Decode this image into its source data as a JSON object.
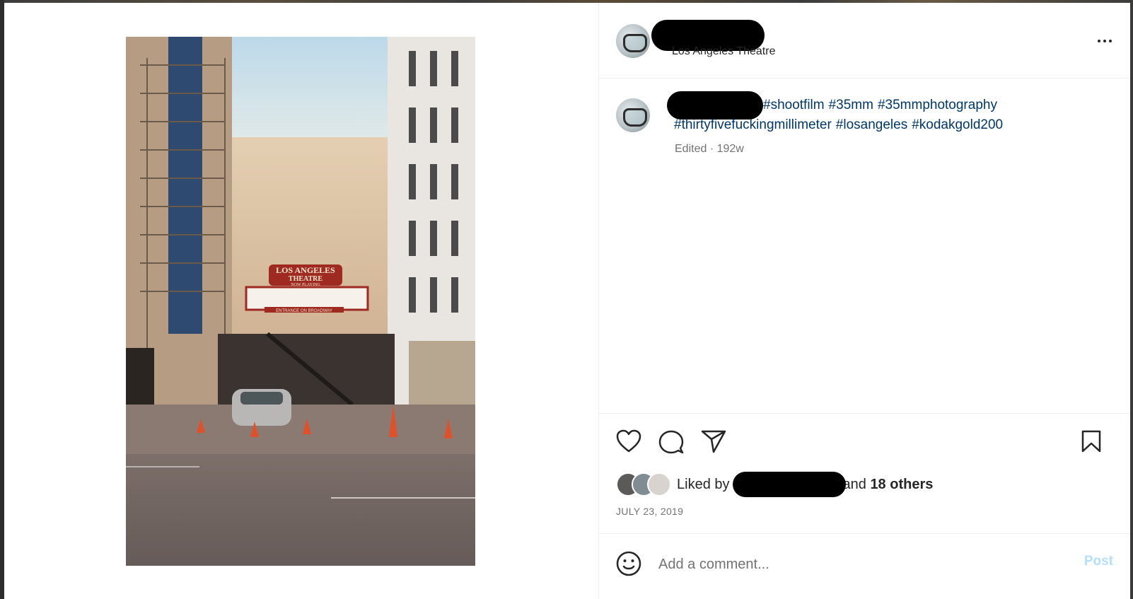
{
  "post": {
    "location": "Los Angeles Theatre",
    "caption_hashtags": [
      "#shootfilm",
      "#35mm",
      "#35mmphotography",
      "#thirtyfivefuckingmillimeter",
      "#losangeles",
      "#kodakgold200"
    ],
    "edited_label": "Edited · 192w",
    "liked_by_prefix": "Liked by",
    "liked_by_and": "and",
    "liked_by_others": "18 others",
    "date": "JULY 23, 2019"
  },
  "photo": {
    "sign_line1": "LOS ANGELES",
    "sign_line2": "THEATRE",
    "sign_line3": "NOW PLAYING",
    "marquee_lower": "ENTRANCE ON BROADWAY"
  },
  "comment": {
    "placeholder": "Add a comment...",
    "post_label": "Post"
  },
  "icons": {
    "more": "more-options-icon",
    "like": "heart-icon",
    "comment": "comment-bubble-icon",
    "share": "paper-plane-icon",
    "save": "bookmark-icon",
    "emoji": "smiley-icon"
  },
  "colors": {
    "hashtag": "#00376b",
    "secondary_text": "#737373",
    "post_button_disabled": "#b2dffc"
  }
}
